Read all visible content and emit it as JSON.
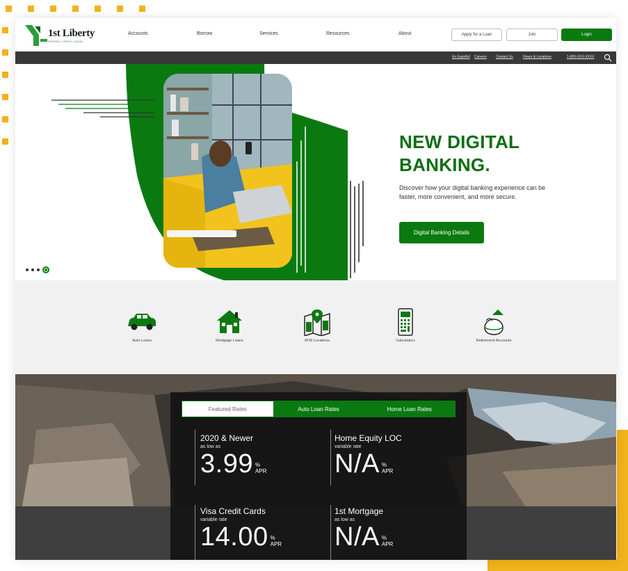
{
  "brand": {
    "name": "1st Liberty",
    "tagline": "FEDERAL CREDIT UNION",
    "green": "#0a7a10",
    "accent": "#f2b21b"
  },
  "nav": {
    "items": [
      "Accounts",
      "Borrow",
      "Services",
      "Resources",
      "About"
    ],
    "apply_label": "Apply for a Loan",
    "join_label": "Join",
    "login_label": "Login"
  },
  "utility": {
    "links": [
      "En Español",
      "Careers",
      "Contact Us",
      "Hours & Locations",
      "1-800-XXX-XXXX"
    ],
    "search_icon": "search-icon"
  },
  "hero": {
    "title_line1": "NEW DIGITAL",
    "title_line2": "BANKING.",
    "description": "Discover how your digital banking experience can be faster, more convenient, and more secure.",
    "cta_label": "Digital Banking Details",
    "slide_count": 4,
    "active_slide": 4
  },
  "quick_links": [
    {
      "label": "Auto Loans",
      "icon": "car-icon"
    },
    {
      "label": "Mortgage Loans",
      "icon": "house-icon"
    },
    {
      "label": "ATM Locations",
      "icon": "map-pin-icon"
    },
    {
      "label": "Calculators",
      "icon": "calculator-icon"
    },
    {
      "label": "Retirement Accounts",
      "icon": "nest-egg-icon"
    }
  ],
  "rates": {
    "tabs": [
      "Featured Rates",
      "Auto Loan Rates",
      "Home Loan Rates"
    ],
    "active_tab": "Featured Rates",
    "items": [
      {
        "title": "2020 & Newer",
        "qualifier": "as low as",
        "value": "3.99",
        "unit_top": "%",
        "unit_bottom": "APR"
      },
      {
        "title": "Home Equity LOC",
        "qualifier": "variable rate",
        "value": "N/A",
        "unit_top": "%",
        "unit_bottom": "APR"
      },
      {
        "title": "Visa Credit Cards",
        "qualifier": "variable rate",
        "value": "14.00",
        "unit_top": "%",
        "unit_bottom": "APR"
      },
      {
        "title": "1st Mortgage",
        "qualifier": "as low as",
        "value": "N/A",
        "unit_top": "%",
        "unit_bottom": "APR"
      }
    ]
  }
}
